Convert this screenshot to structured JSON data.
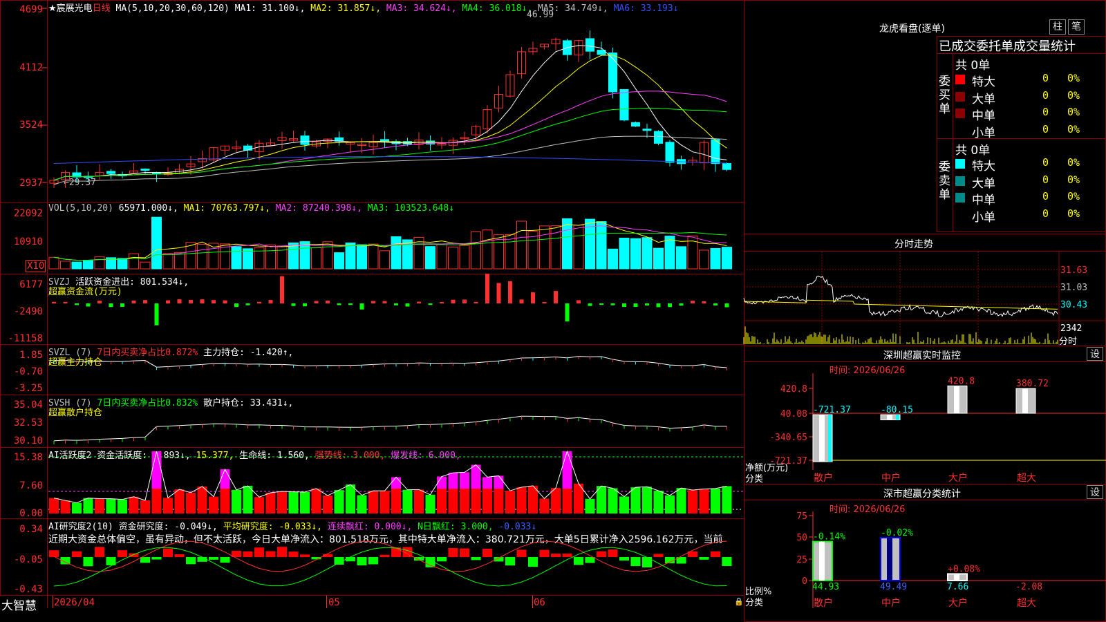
{
  "main": {
    "title_prefix": "★宸展光电",
    "period": "日线",
    "ma_params": "MA(5,10,20,30,60,120)",
    "ma1": "MA1: 31.100↓,",
    "ma2": "MA2: 31.857↓,",
    "ma3": "MA3: 34.624↓,",
    "ma4": "MA4: 36.018↓,",
    "ma5": "MA5: 34.749↓,",
    "ma6": "MA6: 33.193↓",
    "high_marker": "46.99",
    "low_marker": "←29.37",
    "y_ticks": [
      "4699",
      "4112",
      "3524",
      "2937"
    ]
  },
  "vol": {
    "label": "VOL(5,10,20)",
    "value": "65971.000↓,",
    "ma1": "MA1: 70763.797↓,",
    "ma2": "MA2: 87240.398↓,",
    "ma3": "MA3: 103523.648↓",
    "y_ticks": [
      "22092",
      "10910"
    ],
    "unit": "X10"
  },
  "svzj": {
    "label": "SVZJ",
    "text": "活跃资金进出: 801.534↓,",
    "sub": "超赢资金流(万元)",
    "y_ticks": [
      "6177",
      "-2490",
      "-11158"
    ]
  },
  "svzl": {
    "label": "SVZL (7)",
    "part1": "7日内买卖净占比0.872%",
    "part2": "主力持仓: -1.420↑,",
    "sub": "超赢主力持仓",
    "y_ticks": [
      "1.85",
      "-0.70",
      "-3.25"
    ]
  },
  "svsh": {
    "label": "SVSH (7)",
    "part1": "7日内买卖净占比0.832%",
    "part2": "散户持仓: 33.431↓,",
    "sub": "超赢散户持仓",
    "y_ticks": [
      "35.04",
      "32.53",
      "30.10"
    ]
  },
  "ai2": {
    "label": "AI活跃度2 资金活跃度: 2.893↓,",
    "v2": "15.377,",
    "v3": "生命线: 1.560,",
    "v4": "强势线: 3.000,",
    "v5": "爆发线: 6.000,",
    "y_ticks": [
      "15.38",
      "7.60",
      "0.00"
    ]
  },
  "ai3": {
    "label": "AI研究度2(10) 资金研究度: -0.049↓,",
    "v2": "平均研究度: -0.033↓,",
    "v3": "连续飘红: 0.000↓,",
    "v4": "N日飘红: 3.000,",
    "v5": "-0.033↓",
    "comment": "近期大资金总体偏空，虽有异动，但不太活跃，今日大单净流入：801.518万元，其中特大单净流入：380.721万元，大单5日累计净入2596.162万元，当前",
    "y_ticks": [
      "0.34",
      "-0.05",
      "-0.43"
    ]
  },
  "bottom": {
    "brand": "大智慧",
    "d1": "2026/04",
    "d2": "05",
    "d3": "06"
  },
  "right": {
    "lhb_title": "龙虎看盘(逐单)",
    "btn1": "柱",
    "btn2": "笔",
    "lhb_header": "已成交委托单成交量统计",
    "buy_side": "委买单",
    "sell_side": "委卖单",
    "buy_total": "共 0单",
    "sell_total": "共 0单",
    "cats": [
      "特大",
      "大单",
      "中单",
      "小单"
    ],
    "zero": "0",
    "pct": "0%",
    "buy_colors": [
      "#ff0000",
      "#8b0000",
      "#8b0000",
      "#000000"
    ],
    "sell_colors": [
      "#00ffff",
      "#008b8b",
      "#008b8b",
      "#000000"
    ],
    "fs_title": "分时走势",
    "fs_ticks": [
      "31.63",
      "31.03",
      "30.43"
    ],
    "fs_vol": "2342",
    "fs_vol_unit": "手",
    "fs_vol_label": "分时",
    "sz_title": "深圳超赢实时监控",
    "sz_btn": "设",
    "sz_time": "时间: 2026/06/26",
    "sz_ticks": [
      "420.8",
      "40.08",
      "-340.65",
      "-721.37"
    ],
    "sz_y_label1": "净额(万元)",
    "sz_y_label2": "分类",
    "sz_cats": [
      "散户",
      "中户",
      "大户",
      "超大"
    ],
    "sz_vals": [
      "-721.37",
      "-80.15",
      "420.8",
      "380.72"
    ],
    "ss_title": "深市超赢分类统计",
    "ss_btn": "设",
    "ss_time": "时间: 2026/06/26",
    "ss_ticks": [
      "75",
      "50",
      "25",
      "0"
    ],
    "ss_y_label1": "比例%",
    "ss_y_label2": "分类",
    "ss_cats": [
      "散户",
      "中户",
      "大户",
      "超大"
    ],
    "ss_vals": [
      "44.93",
      "49.49",
      "7.66",
      "-2.08"
    ],
    "ss_chg": [
      "-0.14%",
      "-0.02%",
      "+0.08%",
      ""
    ]
  }
}
